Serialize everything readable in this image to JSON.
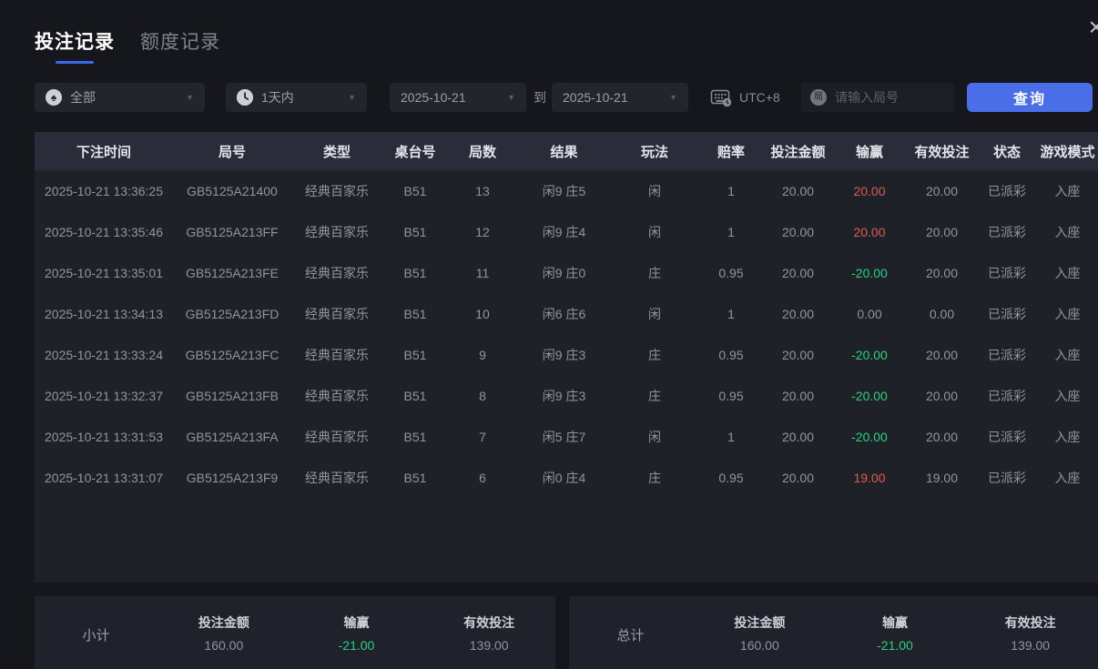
{
  "colors": {
    "accent_blue": "#4a6de8",
    "tab_underline": "#3d68f0",
    "loss_green": "#2ad181",
    "win_red": "#e05a50",
    "panel_bg": "#1f2129",
    "header_bg": "#2a2d39",
    "page_bg": "#16171c"
  },
  "icons": {
    "spade_glyph": "♠",
    "round_glyph": "局",
    "close_glyph": "×",
    "chevron_glyph": "▼"
  },
  "tabs": [
    {
      "label": "投注记录",
      "active": true
    },
    {
      "label": "额度记录",
      "active": false
    }
  ],
  "filters": {
    "game_type_value": "全部",
    "time_range_value": "1天内",
    "date_from": "2025-10-21",
    "to_label": "到",
    "date_to": "2025-10-21",
    "timezone": "UTC+8",
    "round_placeholder": "请输入局号",
    "query_label": "查询"
  },
  "table": {
    "headers": [
      "下注时间",
      "局号",
      "类型",
      "桌台号",
      "局数",
      "结果",
      "玩法",
      "赔率",
      "投注金额",
      "输赢",
      "有效投注",
      "状态",
      "游戏模式"
    ],
    "rows": [
      {
        "time": "2025-10-21 13:36:25",
        "round_id": "GB5125A21400",
        "type": "经典百家乐",
        "table_no": "B51",
        "games": "13",
        "result": "闲9 庄5",
        "play": "闲",
        "odds": "1",
        "bet": "20.00",
        "winloss": "20.00",
        "winloss_color": "red",
        "valid": "20.00",
        "status": "已派彩",
        "mode": "入座"
      },
      {
        "time": "2025-10-21 13:35:46",
        "round_id": "GB5125A213FF",
        "type": "经典百家乐",
        "table_no": "B51",
        "games": "12",
        "result": "闲9 庄4",
        "play": "闲",
        "odds": "1",
        "bet": "20.00",
        "winloss": "20.00",
        "winloss_color": "red",
        "valid": "20.00",
        "status": "已派彩",
        "mode": "入座"
      },
      {
        "time": "2025-10-21 13:35:01",
        "round_id": "GB5125A213FE",
        "type": "经典百家乐",
        "table_no": "B51",
        "games": "11",
        "result": "闲9 庄0",
        "play": "庄",
        "odds": "0.95",
        "bet": "20.00",
        "winloss": "-20.00",
        "winloss_color": "green",
        "valid": "20.00",
        "status": "已派彩",
        "mode": "入座"
      },
      {
        "time": "2025-10-21 13:34:13",
        "round_id": "GB5125A213FD",
        "type": "经典百家乐",
        "table_no": "B51",
        "games": "10",
        "result": "闲6 庄6",
        "play": "闲",
        "odds": "1",
        "bet": "20.00",
        "winloss": "0.00",
        "winloss_color": "neutral",
        "valid": "0.00",
        "status": "已派彩",
        "mode": "入座"
      },
      {
        "time": "2025-10-21 13:33:24",
        "round_id": "GB5125A213FC",
        "type": "经典百家乐",
        "table_no": "B51",
        "games": "9",
        "result": "闲9 庄3",
        "play": "庄",
        "odds": "0.95",
        "bet": "20.00",
        "winloss": "-20.00",
        "winloss_color": "green",
        "valid": "20.00",
        "status": "已派彩",
        "mode": "入座"
      },
      {
        "time": "2025-10-21 13:32:37",
        "round_id": "GB5125A213FB",
        "type": "经典百家乐",
        "table_no": "B51",
        "games": "8",
        "result": "闲9 庄3",
        "play": "庄",
        "odds": "0.95",
        "bet": "20.00",
        "winloss": "-20.00",
        "winloss_color": "green",
        "valid": "20.00",
        "status": "已派彩",
        "mode": "入座"
      },
      {
        "time": "2025-10-21 13:31:53",
        "round_id": "GB5125A213FA",
        "type": "经典百家乐",
        "table_no": "B51",
        "games": "7",
        "result": "闲5 庄7",
        "play": "闲",
        "odds": "1",
        "bet": "20.00",
        "winloss": "-20.00",
        "winloss_color": "green",
        "valid": "20.00",
        "status": "已派彩",
        "mode": "入座"
      },
      {
        "time": "2025-10-21 13:31:07",
        "round_id": "GB5125A213F9",
        "type": "经典百家乐",
        "table_no": "B51",
        "games": "6",
        "result": "闲0 庄4",
        "play": "庄",
        "odds": "0.95",
        "bet": "20.00",
        "winloss": "19.00",
        "winloss_color": "red",
        "valid": "19.00",
        "status": "已派彩",
        "mode": "入座"
      }
    ]
  },
  "summary": {
    "subtotal": {
      "label": "小计",
      "groups": [
        {
          "label": "投注金额",
          "value": "160.00",
          "color": "neutral"
        },
        {
          "label": "输赢",
          "value": "-21.00",
          "color": "green"
        },
        {
          "label": "有效投注",
          "value": "139.00",
          "color": "neutral"
        }
      ]
    },
    "total": {
      "label": "总计",
      "groups": [
        {
          "label": "投注金额",
          "value": "160.00",
          "color": "neutral"
        },
        {
          "label": "输赢",
          "value": "-21.00",
          "color": "green"
        },
        {
          "label": "有效投注",
          "value": "139.00",
          "color": "neutral"
        }
      ]
    }
  }
}
